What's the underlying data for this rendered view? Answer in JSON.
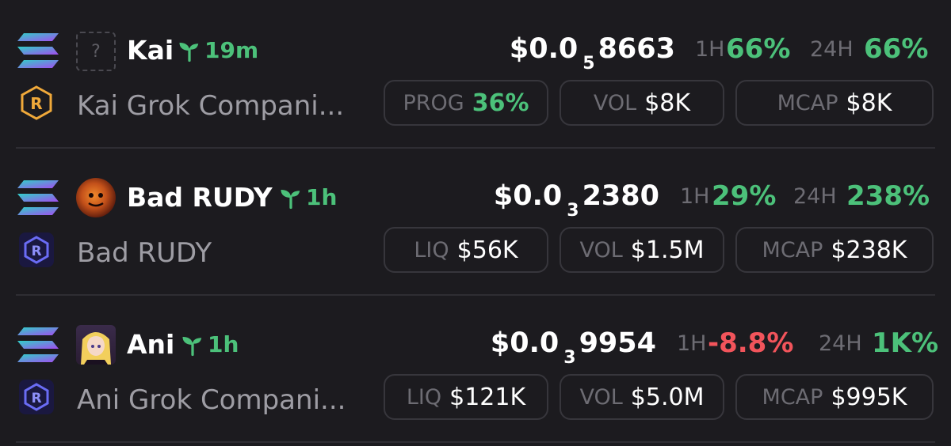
{
  "tokens": [
    {
      "name": "Kai",
      "age": "19m",
      "full_name": "Kai Grok Compani...",
      "price": {
        "prefix": "$0.0",
        "zeros": "5",
        "digits": "8663"
      },
      "change_1h_label": "1H",
      "change_1h": "66%",
      "change_24h_label": "24H",
      "change_24h": "66%",
      "avatar": "question-placeholder",
      "dex": "raydium-launchpad-icon",
      "stats": [
        {
          "label": "PROG",
          "value": "36%"
        },
        {
          "label": "VOL",
          "value": "$8K"
        },
        {
          "label": "MCAP",
          "value": "$8K"
        }
      ]
    },
    {
      "name": "Bad RUDY",
      "age": "1h",
      "full_name": "Bad RUDY",
      "price": {
        "prefix": "$0.0",
        "zeros": "3",
        "digits": "2380"
      },
      "change_1h_label": "1H",
      "change_1h": "29%",
      "change_24h_label": "24H",
      "change_24h": "238%",
      "avatar": "token-avatar",
      "dex": "raydium-icon",
      "stats": [
        {
          "label": "LIQ",
          "value": "$56K"
        },
        {
          "label": "VOL",
          "value": "$1.5M"
        },
        {
          "label": "MCAP",
          "value": "$238K"
        }
      ]
    },
    {
      "name": "Ani",
      "age": "1h",
      "full_name": "Ani Grok Compani...",
      "price": {
        "prefix": "$0.0",
        "zeros": "3",
        "digits": "9954"
      },
      "change_1h_label": "1H",
      "change_1h": "-8.8%",
      "change_24h_label": "24H",
      "change_24h": "1K%",
      "avatar": "token-avatar",
      "dex": "raydium-icon",
      "stats": [
        {
          "label": "LIQ",
          "value": "$121K"
        },
        {
          "label": "VOL",
          "value": "$5.0M"
        },
        {
          "label": "MCAP",
          "value": "$995K"
        }
      ]
    }
  ],
  "colors": {
    "background": "#1c1b1f",
    "positive": "#4cc17a",
    "negative": "#f2545b",
    "muted": "#6d6c73",
    "border": "#37363c"
  },
  "icons": {
    "chain": "solana-icon",
    "new": "sprout-icon"
  }
}
